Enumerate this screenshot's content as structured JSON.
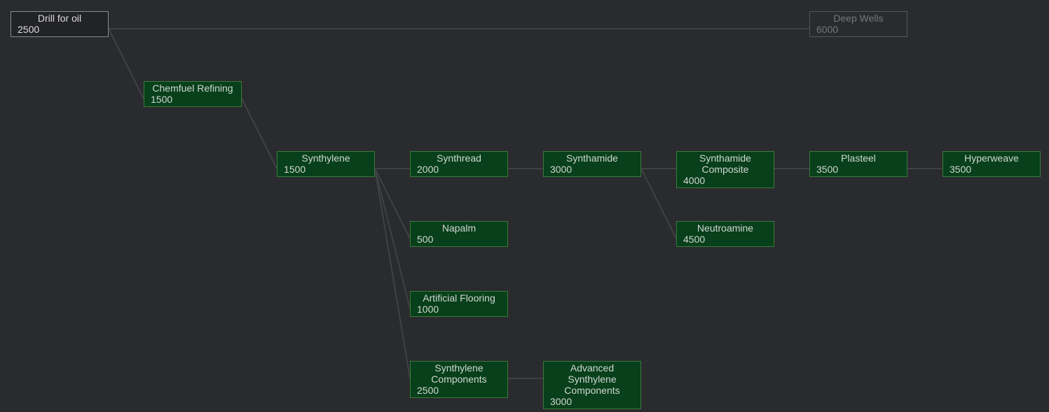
{
  "research_tree": {
    "nodes": [
      {
        "id": "drill_for_oil",
        "title": "Drill for oil",
        "cost": "2500",
        "state": "available"
      },
      {
        "id": "deep_wells",
        "title": "Deep Wells",
        "cost": "6000",
        "state": "locked"
      },
      {
        "id": "chemfuel_refining",
        "title": "Chemfuel Refining",
        "cost": "1500",
        "state": "researched"
      },
      {
        "id": "synthylene",
        "title": "Synthylene",
        "cost": "1500",
        "state": "researched"
      },
      {
        "id": "synthread",
        "title": "Synthread",
        "cost": "2000",
        "state": "researched"
      },
      {
        "id": "synthamide",
        "title": "Synthamide",
        "cost": "3000",
        "state": "researched"
      },
      {
        "id": "synthamide_composite",
        "title": "Synthamide Composite",
        "cost": "4000",
        "state": "researched"
      },
      {
        "id": "plasteel",
        "title": "Plasteel",
        "cost": "3500",
        "state": "researched"
      },
      {
        "id": "hyperweave",
        "title": "Hyperweave",
        "cost": "3500",
        "state": "researched"
      },
      {
        "id": "napalm",
        "title": "Napalm",
        "cost": "500",
        "state": "researched"
      },
      {
        "id": "neutroamine",
        "title": "Neutroamine",
        "cost": "4500",
        "state": "researched"
      },
      {
        "id": "artificial_flooring",
        "title": "Artificial Flooring",
        "cost": "1000",
        "state": "researched"
      },
      {
        "id": "synthylene_components",
        "title": "Synthylene Components",
        "cost": "2500",
        "state": "researched"
      },
      {
        "id": "advanced_synthylene_components",
        "title": "Advanced Synthylene Components",
        "cost": "3000",
        "state": "researched"
      }
    ],
    "colors": {
      "background": "#2a2b2e",
      "researched_fill": "#07401a",
      "researched_border": "#3b7a3b",
      "available_fill": "#222326",
      "locked_text": "#76777a",
      "link": "#404144"
    }
  }
}
